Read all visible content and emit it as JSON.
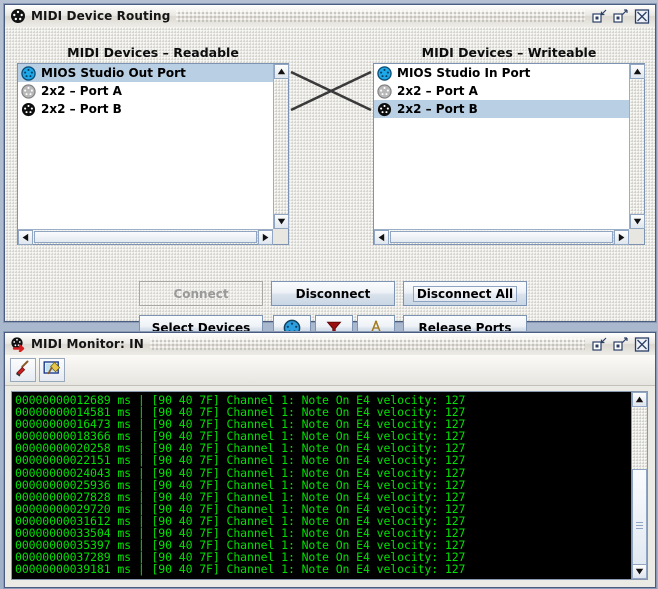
{
  "routing_window": {
    "title": "MIDI Device Routing",
    "title_icon": "midi-din-icon",
    "titlebar_buttons": [
      {
        "name": "restore-down-button",
        "glyph": "restore"
      },
      {
        "name": "maximize-button",
        "glyph": "maximize"
      },
      {
        "name": "close-button",
        "glyph": "close"
      }
    ],
    "readable": {
      "heading": "MIDI Devices – Readable",
      "items": [
        {
          "label": "MIOS Studio Out Port",
          "icon": "midi-din-blue-icon",
          "selected": true
        },
        {
          "label": "2x2 – Port A",
          "icon": "midi-din-gray-icon",
          "selected": false
        },
        {
          "label": "2x2 – Port B",
          "icon": "midi-din-black-icon",
          "selected": false
        }
      ]
    },
    "writeable": {
      "heading": "MIDI Devices – Writeable",
      "items": [
        {
          "label": "MIOS Studio In Port",
          "icon": "midi-din-blue-icon",
          "selected": false
        },
        {
          "label": "2x2 – Port A",
          "icon": "midi-din-gray-icon",
          "selected": false
        },
        {
          "label": "2x2 – Port B",
          "icon": "midi-din-black-icon",
          "selected": true
        }
      ]
    },
    "buttons": {
      "connect": {
        "label": "Connect",
        "enabled": false
      },
      "disconnect": {
        "label": "Disconnect",
        "enabled": true
      },
      "disconnect_all": {
        "label": "Disconnect All",
        "enabled": true,
        "focused": true
      },
      "select_devices": {
        "label": "Select Devices",
        "enabled": true
      },
      "release_ports": {
        "label": "Release Ports",
        "enabled": true
      },
      "midi_icon": {
        "name": "midi-port-icon",
        "enabled": true
      },
      "filter_icon": {
        "name": "filter-funnel-icon",
        "enabled": true
      },
      "tools_icon": {
        "name": "compass-divider-icon",
        "enabled": true
      }
    }
  },
  "monitor_window": {
    "title": "MIDI Monitor: IN",
    "title_icon": "midi-in-arrow-icon",
    "titlebar_buttons": [
      {
        "name": "restore-down-button",
        "glyph": "restore"
      },
      {
        "name": "maximize-button",
        "glyph": "maximize"
      },
      {
        "name": "close-button",
        "glyph": "close"
      }
    ],
    "toolbar": [
      {
        "name": "clear-broom-button"
      },
      {
        "name": "clear-window-button"
      }
    ],
    "log_color": "#00e000",
    "log_background": "#000000",
    "log_lines": [
      "00000000012689 ms | [90 40 7F] Channel 1: Note On E4 velocity: 127",
      "00000000014581 ms | [90 40 7F] Channel 1: Note On E4 velocity: 127",
      "00000000016473 ms | [90 40 7F] Channel 1: Note On E4 velocity: 127",
      "00000000018366 ms | [90 40 7F] Channel 1: Note On E4 velocity: 127",
      "00000000020258 ms | [90 40 7F] Channel 1: Note On E4 velocity: 127",
      "00000000022151 ms | [90 40 7F] Channel 1: Note On E4 velocity: 127",
      "00000000024043 ms | [90 40 7F] Channel 1: Note On E4 velocity: 127",
      "00000000025936 ms | [90 40 7F] Channel 1: Note On E4 velocity: 127",
      "00000000027828 ms | [90 40 7F] Channel 1: Note On E4 velocity: 127",
      "00000000029720 ms | [90 40 7F] Channel 1: Note On E4 velocity: 127",
      "00000000031612 ms | [90 40 7F] Channel 1: Note On E4 velocity: 127",
      "00000000033504 ms | [90 40 7F] Channel 1: Note On E4 velocity: 127",
      "00000000035397 ms | [90 40 7F] Channel 1: Note On E4 velocity: 127",
      "00000000037289 ms | [90 40 7F] Channel 1: Note On E4 velocity: 127",
      "00000000039181 ms | [90 40 7F] Channel 1: Note On E4 velocity: 127"
    ]
  },
  "connections": [
    {
      "from_index": 0,
      "to_index": 2
    },
    {
      "from_index": 2,
      "to_index": 0
    }
  ]
}
